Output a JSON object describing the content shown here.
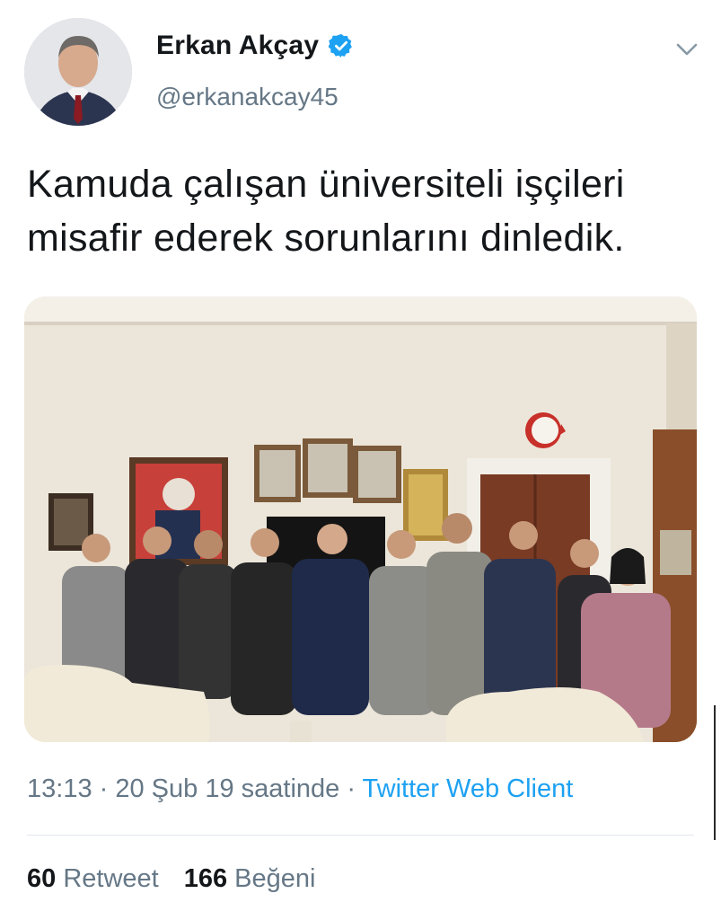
{
  "header": {
    "display_name": "Erkan Akçay",
    "handle": "@erkanakcay45",
    "verified": true,
    "avatar_icon": "profile-photo",
    "menu_icon": "chevron-down-icon"
  },
  "tweet": {
    "text_line1": "Kamuda çalışan üniversiteli işçileri",
    "text_line2": "misafir ederek sorunlarını dinledik."
  },
  "meta": {
    "time": "13:13",
    "separator1": " · ",
    "date": "20 Şub 19 saatinde",
    "separator2": " · ",
    "client": "Twitter Web Client"
  },
  "stats": {
    "retweet_count": "60",
    "retweet_label": "Retweet",
    "like_count": "166",
    "like_label": "Beğeni"
  },
  "colors": {
    "link": "#1da1f2",
    "secondary_text": "#657786",
    "primary_text": "#14171a",
    "verified_badge": "#1da1f2"
  }
}
